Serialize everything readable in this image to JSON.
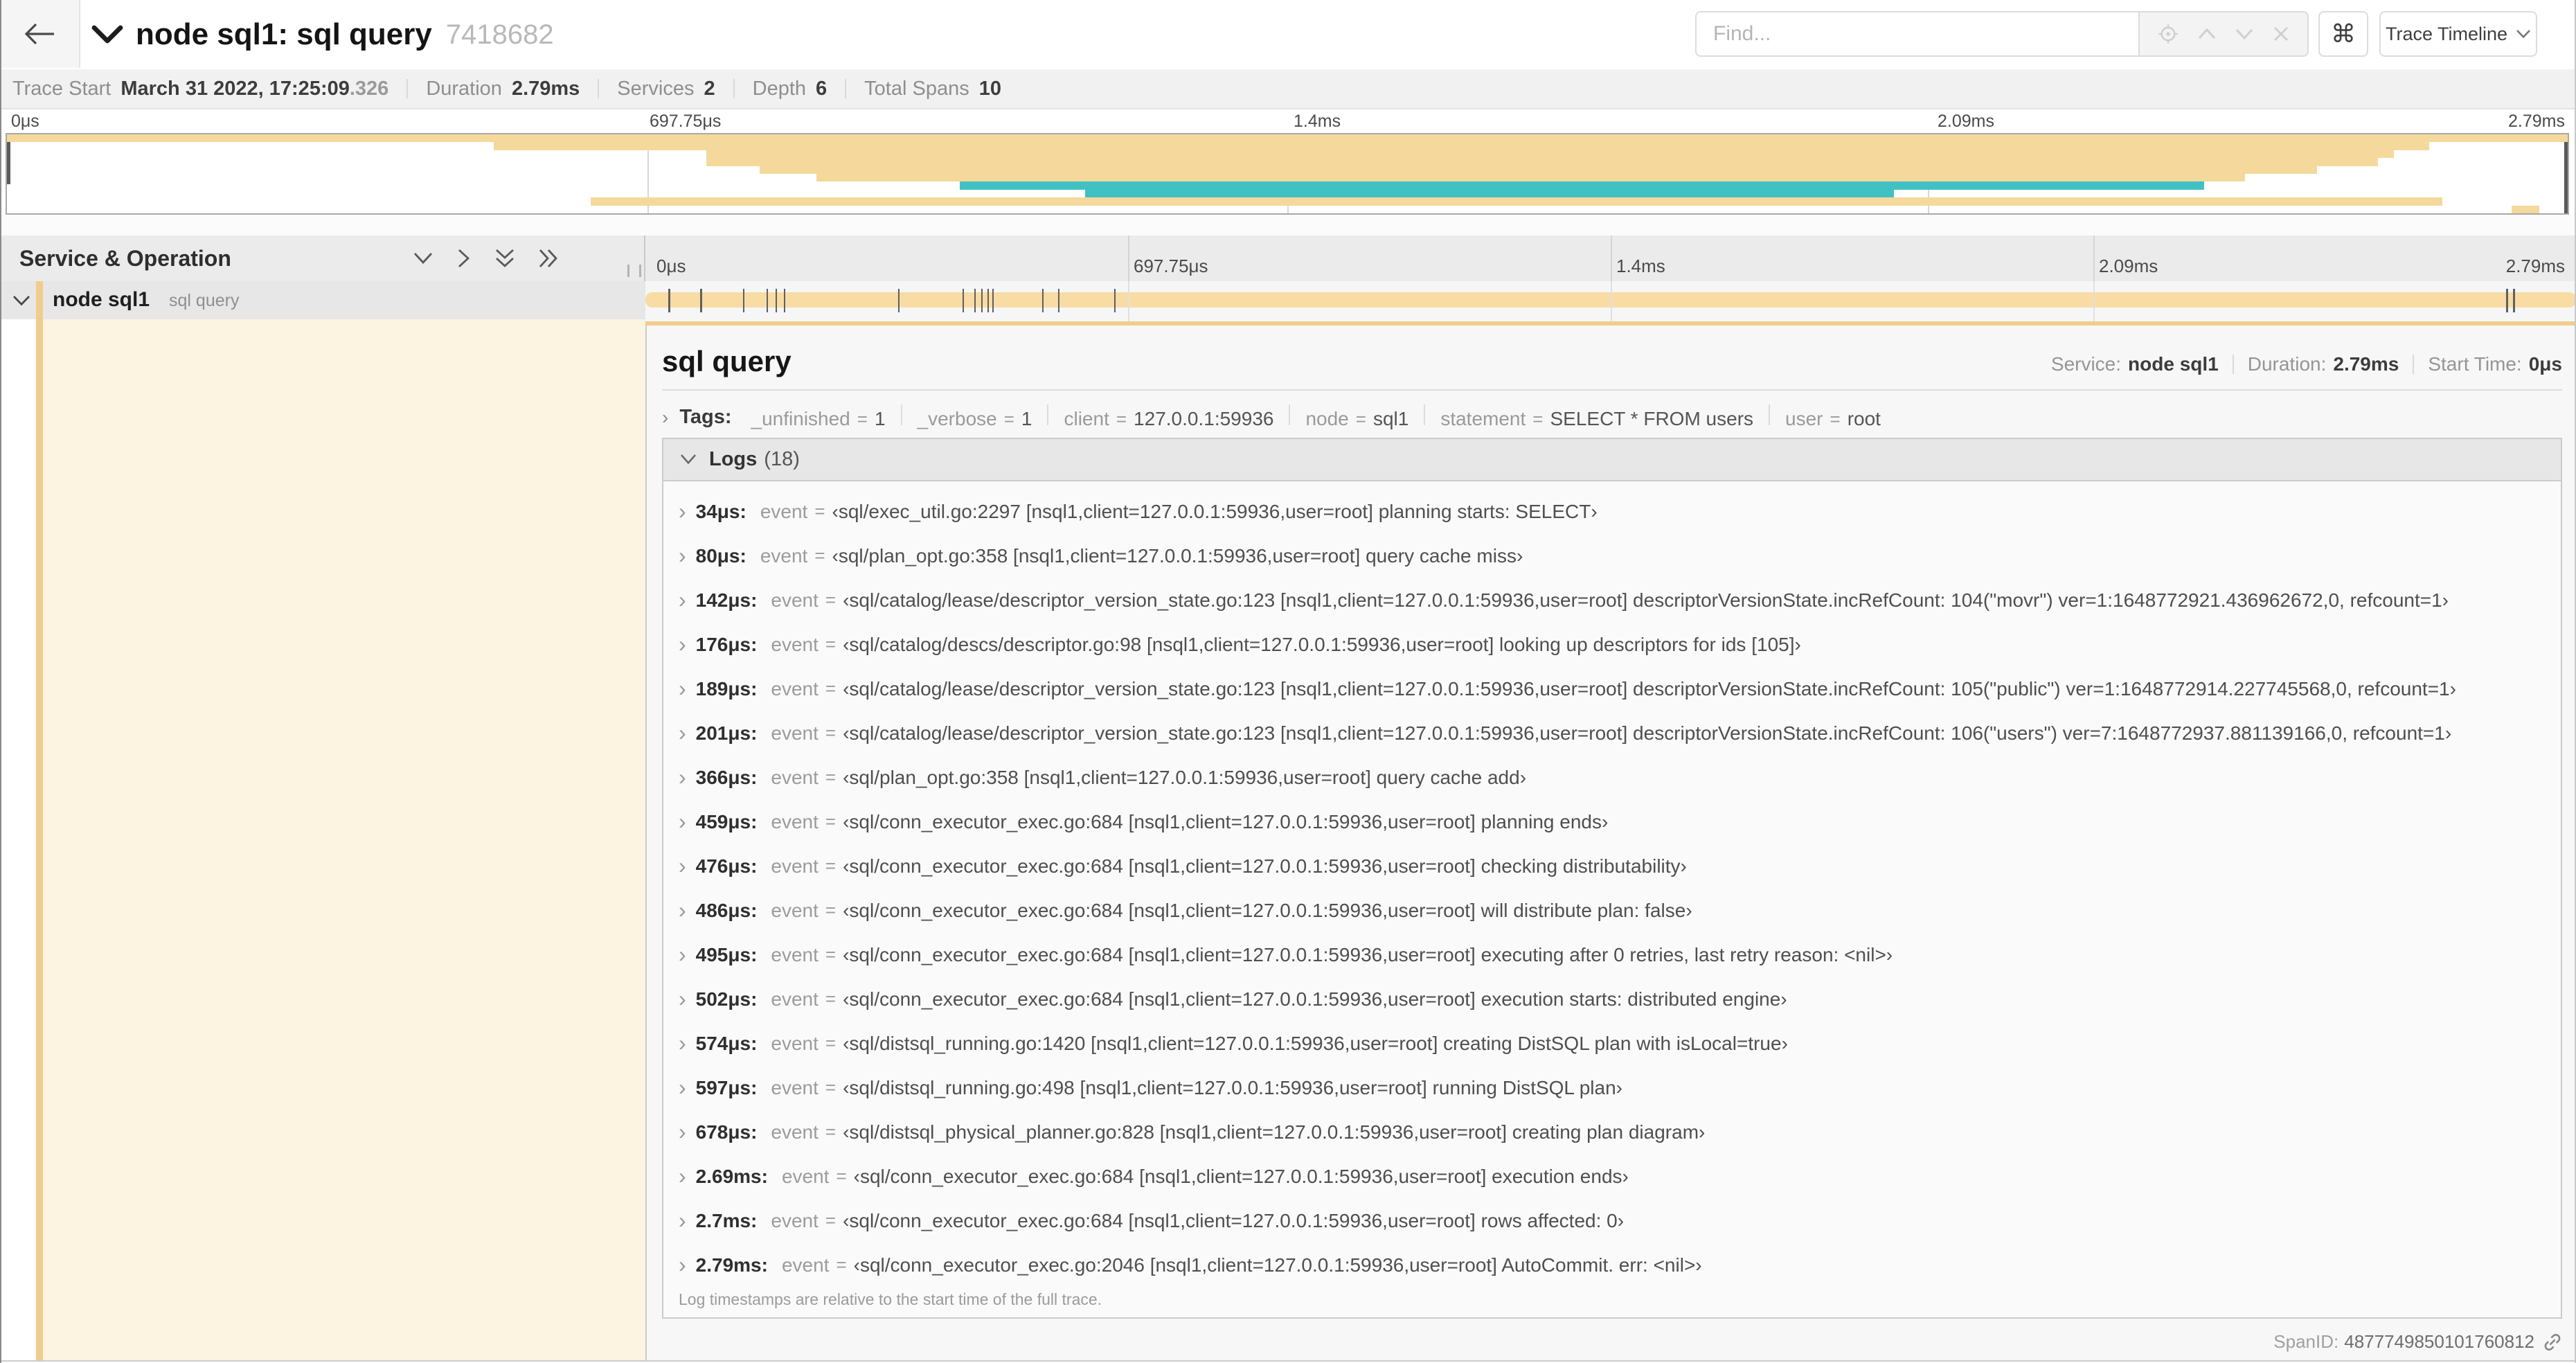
{
  "header": {
    "back_icon": "arrow-left",
    "title": "node sql1: sql query",
    "trace_id": "7418682",
    "find_placeholder": "Find...",
    "cmd_label": "⌘",
    "view_button": "Trace Timeline"
  },
  "stats": [
    {
      "label": "Trace Start",
      "value": "March 31 2022, 17:25:09",
      "suffix": ".326"
    },
    {
      "label": "Duration",
      "value": "2.79ms"
    },
    {
      "label": "Services",
      "value": "2"
    },
    {
      "label": "Depth",
      "value": "6"
    },
    {
      "label": "Total Spans",
      "value": "10"
    }
  ],
  "ticks": [
    {
      "label": "0μs",
      "f": 0
    },
    {
      "label": "697.75μs",
      "f": 0.25
    },
    {
      "label": "1.4ms",
      "f": 0.5
    },
    {
      "label": "2.09ms",
      "f": 0.75
    },
    {
      "label": "2.79ms",
      "f": 1
    }
  ],
  "minimap_spans": [
    {
      "start": 0,
      "end": 1,
      "color": "tan"
    },
    {
      "start": 0.19,
      "end": 0.946,
      "color": "tan"
    },
    {
      "start": 0.273,
      "end": 0.932,
      "color": "tan"
    },
    {
      "start": 0.273,
      "end": 0.926,
      "color": "tan"
    },
    {
      "start": 0.294,
      "end": 0.902,
      "color": "tan"
    },
    {
      "start": 0.316,
      "end": 0.874,
      "color": "tan"
    },
    {
      "start": 0.372,
      "end": 0.858,
      "color": "teal"
    },
    {
      "start": 0.421,
      "end": 0.737,
      "color": "teal"
    },
    {
      "start": 0.228,
      "end": 0.951,
      "color": "tan"
    },
    {
      "start": 0.978,
      "end": 0.989,
      "color": "tan"
    }
  ],
  "left_panel": {
    "header": "Service & Operation",
    "row": {
      "service": "node sql1",
      "operation": "sql query"
    }
  },
  "timeline": {
    "total_us": 2790,
    "log_marks_us": [
      34,
      80,
      142,
      176,
      189,
      201,
      366,
      459,
      476,
      486,
      495,
      502,
      574,
      597,
      678,
      2690,
      2700,
      2790
    ]
  },
  "detail": {
    "title": "sql query",
    "meta": [
      {
        "label": "Service:",
        "value": "node sql1"
      },
      {
        "label": "Duration:",
        "value": "2.79ms"
      },
      {
        "label": "Start Time:",
        "value": "0μs"
      }
    ],
    "tags_label": "Tags:",
    "tags": [
      {
        "key": "_unfinished",
        "value": "1"
      },
      {
        "key": "_verbose",
        "value": "1"
      },
      {
        "key": "client",
        "value": "127.0.0.1:59936"
      },
      {
        "key": "node",
        "value": "sql1"
      },
      {
        "key": "statement",
        "value": "SELECT * FROM users"
      },
      {
        "key": "user",
        "value": "root"
      }
    ],
    "logs_label": "Logs",
    "logs_count": "(18)",
    "event_key": "event",
    "logs": [
      {
        "t": "34μs:",
        "m": "‹sql/exec_util.go:2297 [nsql1,client=127.0.0.1:59936,user=root] planning starts: SELECT›"
      },
      {
        "t": "80μs:",
        "m": "‹sql/plan_opt.go:358 [nsql1,client=127.0.0.1:59936,user=root] query cache miss›"
      },
      {
        "t": "142μs:",
        "m": "‹sql/catalog/lease/descriptor_version_state.go:123 [nsql1,client=127.0.0.1:59936,user=root] descriptorVersionState.incRefCount: 104(\"movr\") ver=1:1648772921.436962672,0, refcount=1›"
      },
      {
        "t": "176μs:",
        "m": "‹sql/catalog/descs/descriptor.go:98 [nsql1,client=127.0.0.1:59936,user=root] looking up descriptors for ids [105]›"
      },
      {
        "t": "189μs:",
        "m": "‹sql/catalog/lease/descriptor_version_state.go:123 [nsql1,client=127.0.0.1:59936,user=root] descriptorVersionState.incRefCount: 105(\"public\") ver=1:1648772914.227745568,0, refcount=1›"
      },
      {
        "t": "201μs:",
        "m": "‹sql/catalog/lease/descriptor_version_state.go:123 [nsql1,client=127.0.0.1:59936,user=root] descriptorVersionState.incRefCount: 106(\"users\") ver=7:1648772937.881139166,0, refcount=1›"
      },
      {
        "t": "366μs:",
        "m": "‹sql/plan_opt.go:358 [nsql1,client=127.0.0.1:59936,user=root] query cache add›"
      },
      {
        "t": "459μs:",
        "m": "‹sql/conn_executor_exec.go:684 [nsql1,client=127.0.0.1:59936,user=root] planning ends›"
      },
      {
        "t": "476μs:",
        "m": "‹sql/conn_executor_exec.go:684 [nsql1,client=127.0.0.1:59936,user=root] checking distributability›"
      },
      {
        "t": "486μs:",
        "m": "‹sql/conn_executor_exec.go:684 [nsql1,client=127.0.0.1:59936,user=root] will distribute plan: false›"
      },
      {
        "t": "495μs:",
        "m": "‹sql/conn_executor_exec.go:684 [nsql1,client=127.0.0.1:59936,user=root] executing after 0 retries, last retry reason: <nil>›"
      },
      {
        "t": "502μs:",
        "m": "‹sql/conn_executor_exec.go:684 [nsql1,client=127.0.0.1:59936,user=root] execution starts: distributed engine›"
      },
      {
        "t": "574μs:",
        "m": "‹sql/distsql_running.go:1420 [nsql1,client=127.0.0.1:59936,user=root] creating DistSQL plan with isLocal=true›"
      },
      {
        "t": "597μs:",
        "m": "‹sql/distsql_running.go:498 [nsql1,client=127.0.0.1:59936,user=root] running DistSQL plan›"
      },
      {
        "t": "678μs:",
        "m": "‹sql/distsql_physical_planner.go:828 [nsql1,client=127.0.0.1:59936,user=root] creating plan diagram›"
      },
      {
        "t": "2.69ms:",
        "m": "‹sql/conn_executor_exec.go:684 [nsql1,client=127.0.0.1:59936,user=root] execution ends›"
      },
      {
        "t": "2.7ms:",
        "m": "‹sql/conn_executor_exec.go:684 [nsql1,client=127.0.0.1:59936,user=root] rows affected: 0›"
      },
      {
        "t": "2.79ms:",
        "m": "‹sql/conn_executor_exec.go:2046 [nsql1,client=127.0.0.1:59936,user=root] AutoCommit. err: <nil>›"
      }
    ],
    "footer_note": "Log timestamps are relative to the start time of the full trace.",
    "spanid_label": "SpanID:",
    "spanid_value": "4877749850101760812"
  },
  "colors": {
    "tan": "#f5d99c",
    "teal": "#41c1c4",
    "accent_stripe": "#f1cd8c",
    "cream": "#fcf4e0"
  }
}
